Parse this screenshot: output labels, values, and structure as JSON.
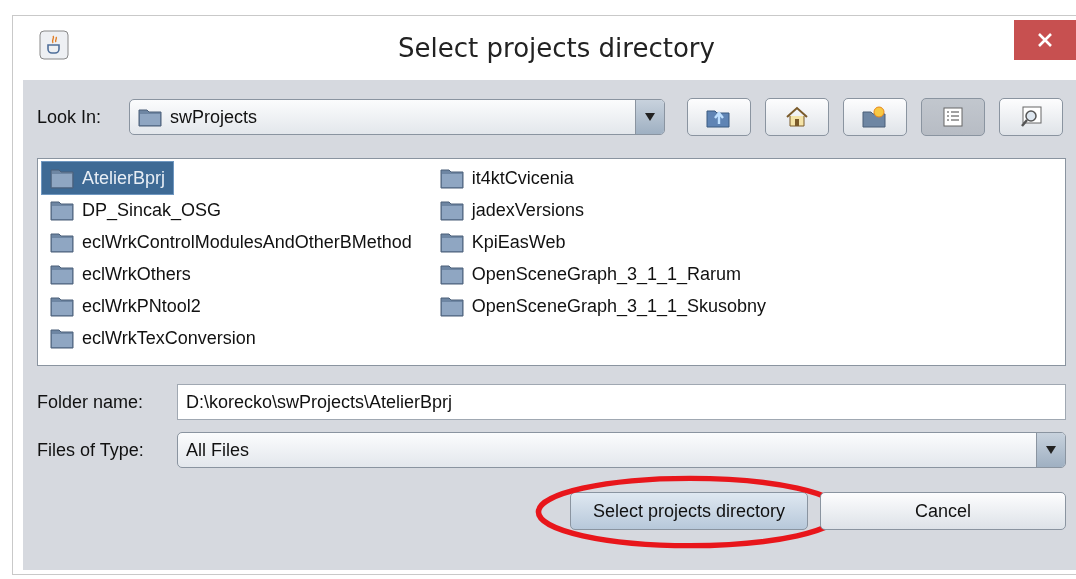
{
  "window": {
    "title": "Select projects directory"
  },
  "look_in": {
    "label": "Look In:",
    "value": "swProjects"
  },
  "toolbar": [
    {
      "kind": "up",
      "selected": false
    },
    {
      "kind": "home",
      "selected": false
    },
    {
      "kind": "new-folder",
      "selected": false
    },
    {
      "kind": "list",
      "selected": true
    },
    {
      "kind": "details",
      "selected": false
    }
  ],
  "files": [
    {
      "name": "AtelierBprj",
      "selected": true
    },
    {
      "name": "DP_Sincak_OSG",
      "selected": false
    },
    {
      "name": "eclWrkControlModulesAndOtherBMethod",
      "selected": false
    },
    {
      "name": "eclWrkOthers",
      "selected": false
    },
    {
      "name": "eclWrkPNtool2",
      "selected": false
    },
    {
      "name": "eclWrkTexConversion",
      "selected": false
    },
    {
      "name": "it4ktCvicenia",
      "selected": false
    },
    {
      "name": "jadexVersions",
      "selected": false
    },
    {
      "name": "KpiEasWeb",
      "selected": false
    },
    {
      "name": "OpenSceneGraph_3_1_1_Rarum",
      "selected": false
    },
    {
      "name": "OpenSceneGraph_3_1_1_Skusobny",
      "selected": false
    }
  ],
  "folder_name": {
    "label": "Folder name:",
    "value": "D:\\korecko\\swProjects\\AtelierBprj"
  },
  "files_of_type": {
    "label": "Files of Type:",
    "value": "All Files"
  },
  "buttons": [
    {
      "label": "Select projects directory",
      "highlighted": true
    },
    {
      "label": "Cancel",
      "highlighted": false
    }
  ]
}
